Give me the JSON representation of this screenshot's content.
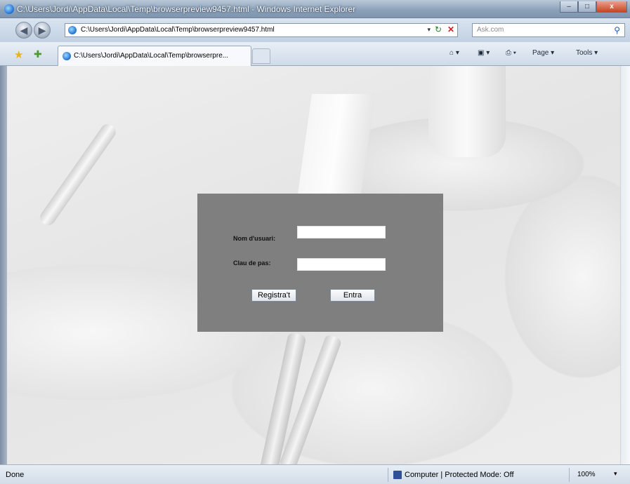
{
  "window": {
    "title": "C:\\Users\\Jordi\\AppData\\Local\\Temp\\browserpreview9457.html - Windows Internet Explorer",
    "caption_close": "x"
  },
  "address_bar": {
    "url": "C:\\Users\\Jordi\\AppData\\Local\\Temp\\browserpreview9457.html",
    "dropdown": "▾",
    "refresh": "↻",
    "stop": "✕"
  },
  "search": {
    "placeholder": "Ask.com",
    "icon": "search-icon"
  },
  "tab": {
    "label": "C:\\Users\\Jordi\\AppData\\Local\\Temp\\browserpre..."
  },
  "command_bar": {
    "page": "Page ▾",
    "tools": "Tools ▾"
  },
  "login": {
    "username_label": "Nom d'usuari:",
    "username_value": "",
    "password_label": "Clau de pas:",
    "password_value": "",
    "register_button": "Registra't",
    "enter_button": "Entra"
  },
  "status_bar": {
    "status": "Done",
    "zone": "Computer | Protected Mode: Off",
    "zoom": "100%",
    "zoom_dropdown": "▾"
  }
}
